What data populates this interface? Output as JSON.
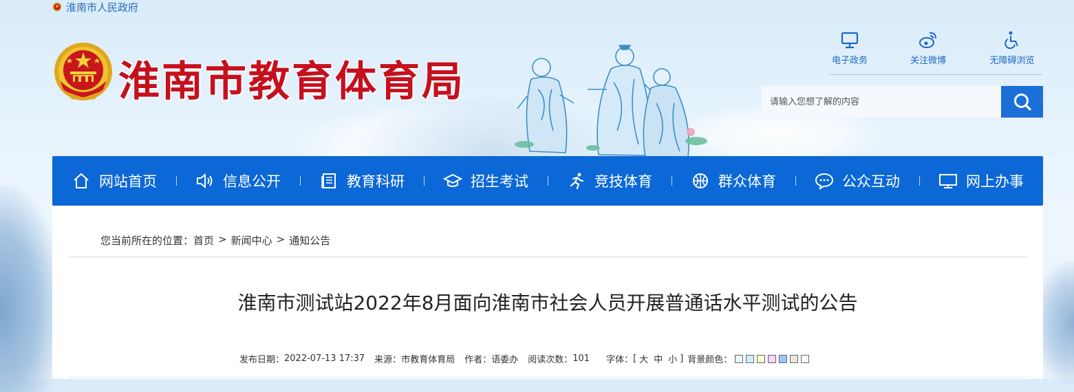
{
  "top_link": {
    "label": "淮南市人民政府"
  },
  "site": {
    "title": "淮南市教育体育局"
  },
  "quick_links": [
    {
      "label": "电子政务",
      "icon": "monitor-icon"
    },
    {
      "label": "关注微博",
      "icon": "weibo-icon"
    },
    {
      "label": "无障碍浏览",
      "icon": "wheelchair-icon"
    }
  ],
  "search": {
    "placeholder": "请输入您想了解的内容",
    "icon": "search-icon"
  },
  "nav": [
    {
      "label": "网站首页",
      "icon": "home-icon"
    },
    {
      "label": "信息公开",
      "icon": "speaker-icon"
    },
    {
      "label": "教育科研",
      "icon": "document-icon"
    },
    {
      "label": "招生考试",
      "icon": "graduation-cap-icon"
    },
    {
      "label": "竞技体育",
      "icon": "runner-icon"
    },
    {
      "label": "群众体育",
      "icon": "basketball-icon"
    },
    {
      "label": "公众互动",
      "icon": "chat-bubble-icon"
    },
    {
      "label": "网上办事",
      "icon": "computer-icon"
    }
  ],
  "breadcrumb": {
    "prefix": "您当前所在的位置：",
    "items": [
      "首页",
      "新闻中心",
      "通知公告"
    ],
    "separator": ">"
  },
  "article": {
    "title": "淮南市测试站2022年8月面向淮南市社会人员开展普通话水平测试的公告",
    "meta": {
      "date_label": "发布日期：",
      "date": "2022-07-13 17:37",
      "source_label": "来源：",
      "source": "市教育体育局",
      "author_label": "作者：",
      "author": "语委办",
      "views_label": "阅读次数：",
      "views": "101",
      "font_label": "字体：",
      "font_open": "[",
      "font_sizes": [
        "大",
        "中",
        "小"
      ],
      "font_close": "]",
      "bg_label": "背景颜色：",
      "bg_colors": [
        "#e9f6f9",
        "#cdf0f6",
        "#fdfbd1",
        "#fcd3fb",
        "#9ec6f6",
        "#e6e6e6",
        "#ffffff"
      ]
    }
  },
  "colors": {
    "brand_red": "#c5101e",
    "nav_blue": "#0b68d6",
    "link_blue": "#1c67c4"
  }
}
